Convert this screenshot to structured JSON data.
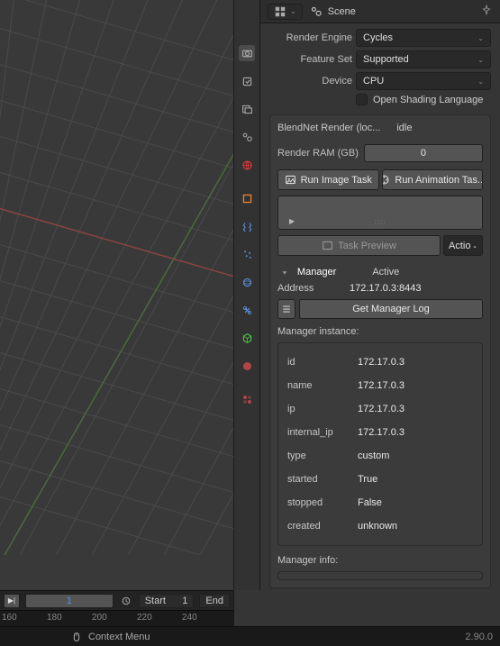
{
  "header": {
    "scene_label": "Scene"
  },
  "render": {
    "engine_label": "Render Engine",
    "engine_value": "Cycles",
    "featureset_label": "Feature Set",
    "featureset_value": "Supported",
    "device_label": "Device",
    "device_value": "CPU",
    "osl_label": "Open Shading Language"
  },
  "blendnet": {
    "title": "BlendNet Render (loc...",
    "status": "idle",
    "ram_label": "Render RAM (GB)",
    "ram_value": "0",
    "run_image": "Run Image Task",
    "run_anim": "Run Animation Tas...",
    "task_preview": "Task Preview",
    "actions": "Actio"
  },
  "manager": {
    "section": "Manager",
    "active": "Active",
    "address_label": "Address",
    "address_value": "172.17.0.3:8443",
    "log_btn": "Get Manager Log",
    "instance_label": "Manager instance:",
    "rows": [
      {
        "k": "id",
        "v": "172.17.0.3"
      },
      {
        "k": "name",
        "v": "172.17.0.3"
      },
      {
        "k": "ip",
        "v": "172.17.0.3"
      },
      {
        "k": "internal_ip",
        "v": "172.17.0.3"
      },
      {
        "k": "type",
        "v": "custom"
      },
      {
        "k": "started",
        "v": "True"
      },
      {
        "k": "stopped",
        "v": "False"
      },
      {
        "k": "created",
        "v": "unknown"
      }
    ],
    "info_label": "Manager info:"
  },
  "timeline": {
    "current": "1",
    "start_label": "Start",
    "start_value": "1",
    "end_label": "End",
    "ticks": [
      "160",
      "180",
      "200",
      "220",
      "240"
    ]
  },
  "status": {
    "context": "Context Menu",
    "version": "2.90.0"
  },
  "icons": {
    "scene": "scene-icon",
    "pin": "pin-icon",
    "camera": "camera-icon"
  }
}
